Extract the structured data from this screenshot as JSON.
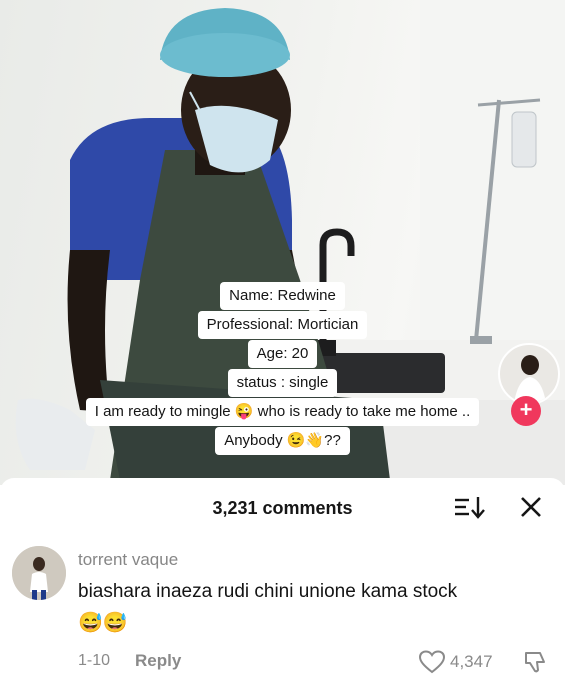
{
  "caption": {
    "lines": [
      "Name: Redwine",
      "Professional: Mortician",
      "Age: 20",
      "status : single",
      "I am ready to mingle 😜 who is ready to take me home ..",
      "Anybody 😉👋??"
    ]
  },
  "sidebar": {
    "follow_label": "+"
  },
  "comments_panel": {
    "count_label": "3,231 comments",
    "sort_icon": "sort-icon",
    "close_icon": "close-icon"
  },
  "comment": {
    "username": "torrent vaque",
    "text": "biashara inaeza rudi chini unione kama stock",
    "emojis": "😅😅",
    "date": "1-10",
    "reply_label": "Reply",
    "likes": "4,347",
    "like_icon": "heart-icon",
    "dislike_icon": "thumbs-down-icon"
  },
  "colors": {
    "accent_follow": "#f0385d",
    "scrubs": "#2f49a8",
    "apron": "#3d4a3f",
    "cap": "#5fb2c6",
    "mask": "#cfe4ee"
  }
}
